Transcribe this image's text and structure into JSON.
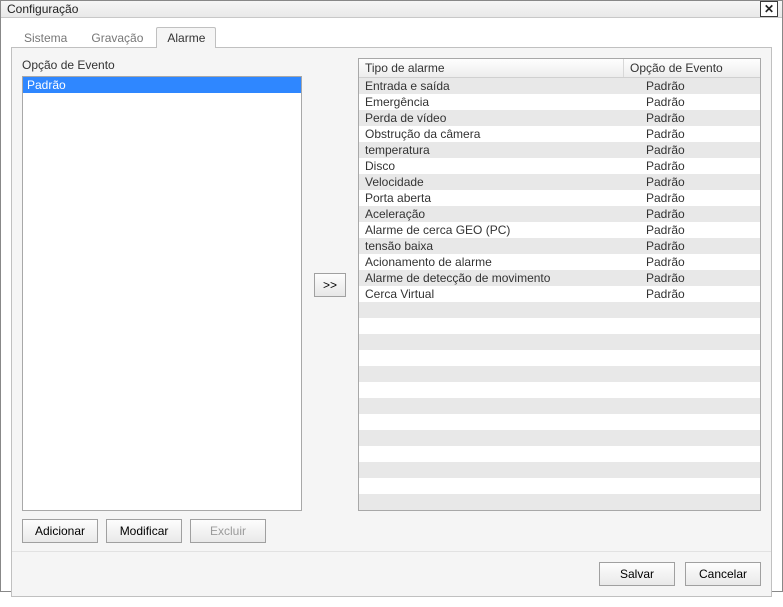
{
  "window": {
    "title": "Configuração",
    "close_glyph": "✕"
  },
  "tabs": [
    {
      "id": "sistema",
      "label": "Sistema",
      "active": false
    },
    {
      "id": "gravacao",
      "label": "Gravação",
      "active": false
    },
    {
      "id": "alarme",
      "label": "Alarme",
      "active": true
    }
  ],
  "left": {
    "label": "Opção de Evento",
    "items": [
      {
        "label": "Padrão",
        "selected": true
      }
    ]
  },
  "assign_btn": ">>",
  "table": {
    "headers": {
      "alarm": "Tipo de alarme",
      "option": "Opção de Evento"
    },
    "rows": [
      {
        "alarm": "Entrada e saída",
        "option": "Padrão"
      },
      {
        "alarm": "Emergência",
        "option": "Padrão"
      },
      {
        "alarm": "Perda de vídeo",
        "option": "Padrão"
      },
      {
        "alarm": "Obstrução da câmera",
        "option": "Padrão"
      },
      {
        "alarm": "temperatura",
        "option": "Padrão"
      },
      {
        "alarm": "Disco",
        "option": "Padrão"
      },
      {
        "alarm": "Velocidade",
        "option": "Padrão"
      },
      {
        "alarm": "Porta aberta",
        "option": "Padrão"
      },
      {
        "alarm": "Aceleração",
        "option": "Padrão"
      },
      {
        "alarm": "Alarme de cerca GEO (PC)",
        "option": "Padrão"
      },
      {
        "alarm": "tensão baixa",
        "option": "Padrão"
      },
      {
        "alarm": "Acionamento de alarme",
        "option": "Padrão"
      },
      {
        "alarm": "Alarme de detecção de movimento",
        "option": "Padrão"
      },
      {
        "alarm": "Cerca Virtual",
        "option": "Padrão"
      }
    ],
    "empty_rows": 13
  },
  "buttons": {
    "add": "Adicionar",
    "modify": "Modificar",
    "delete": "Excluir",
    "save": "Salvar",
    "cancel": "Cancelar"
  }
}
